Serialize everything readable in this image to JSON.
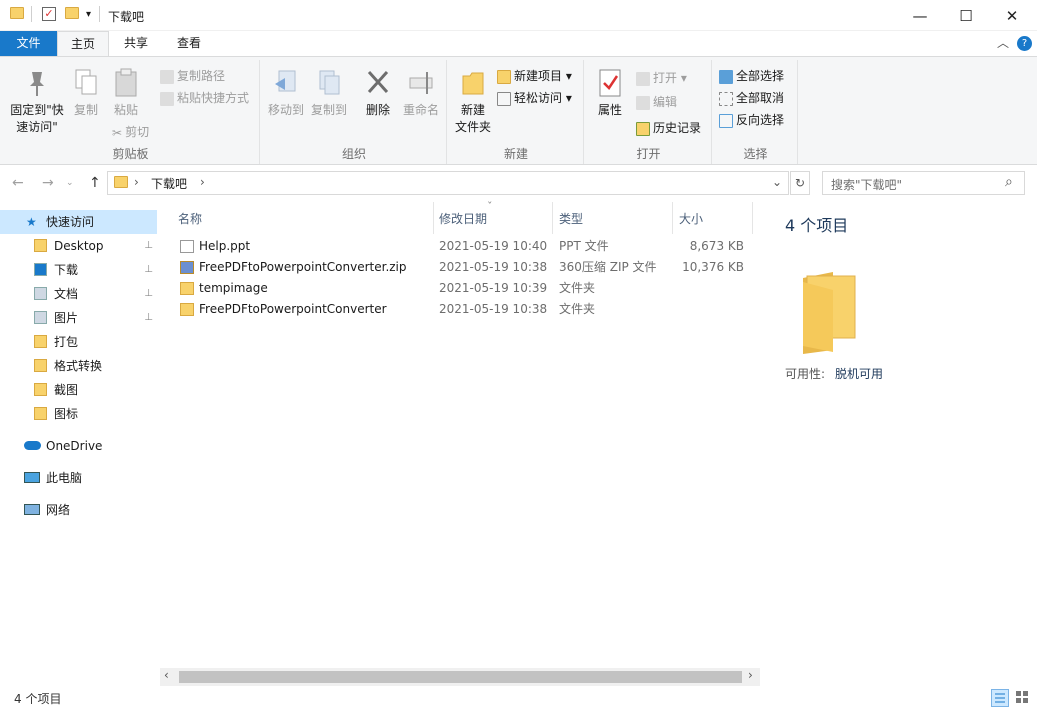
{
  "window": {
    "title": "下载吧",
    "minimize": "—",
    "maximize": "☐",
    "close": "✕",
    "qa_dropdown": "▾"
  },
  "ribbon_tabs": {
    "file": "文件",
    "home": "主页",
    "share": "共享",
    "view": "查看",
    "collapse": "︿",
    "help": "?"
  },
  "ribbon": {
    "clipboard": {
      "label": "剪贴板",
      "pin_line1": "固定到\"快",
      "pin_line2": "速访问\"",
      "copy": "复制",
      "paste": "粘贴",
      "copy_path": "复制路径",
      "paste_shortcut": "粘贴快捷方式",
      "cut": "剪切"
    },
    "organize": {
      "label": "组织",
      "move_to": "移动到",
      "copy_to": "复制到",
      "delete": "删除",
      "rename": "重命名"
    },
    "new": {
      "label": "新建",
      "new_folder_line1": "新建",
      "new_folder_line2": "文件夹",
      "new_item": "新建项目",
      "easy_access": "轻松访问"
    },
    "open": {
      "label": "打开",
      "properties": "属性",
      "open": "打开",
      "edit": "编辑",
      "history": "历史记录"
    },
    "select": {
      "label": "选择",
      "select_all": "全部选择",
      "select_none": "全部取消",
      "invert": "反向选择"
    }
  },
  "address": {
    "path": "下载吧",
    "separator": "›",
    "search_placeholder": "搜索\"下载吧\"",
    "back": "←",
    "forward": "→",
    "dropdown": "⌄",
    "up": "↑",
    "refresh": "↻",
    "search_icon": "⌕"
  },
  "nav": {
    "quick_access": "快速访问",
    "items": [
      {
        "label": "Desktop",
        "pinned": true
      },
      {
        "label": "下载",
        "pinned": true
      },
      {
        "label": "文档",
        "pinned": true
      },
      {
        "label": "图片",
        "pinned": true
      },
      {
        "label": "打包",
        "pinned": false
      },
      {
        "label": "格式转换",
        "pinned": false
      },
      {
        "label": "截图",
        "pinned": false
      },
      {
        "label": "图标",
        "pinned": false
      }
    ],
    "onedrive": "OneDrive",
    "this_pc": "此电脑",
    "network": "网络",
    "pin_glyph": "📌"
  },
  "filelist": {
    "columns": {
      "name": "名称",
      "modified": "修改日期",
      "type": "类型",
      "size": "大小"
    },
    "rows": [
      {
        "name": "Help.ppt",
        "modified": "2021-05-19 10:40",
        "type": "PPT 文件",
        "size": "8,673 KB",
        "icon": "document-icon"
      },
      {
        "name": "FreePDFtoPowerpointConverter.zip",
        "modified": "2021-05-19 10:38",
        "type": "360压缩 ZIP 文件",
        "size": "10,376 KB",
        "icon": "zip-icon"
      },
      {
        "name": "tempimage",
        "modified": "2021-05-19 10:39",
        "type": "文件夹",
        "size": "",
        "icon": "folder-icon"
      },
      {
        "name": "FreePDFtoPowerpointConverter",
        "modified": "2021-05-19 10:38",
        "type": "文件夹",
        "size": "",
        "icon": "folder-icon"
      }
    ],
    "sort_glyph": "ˇ"
  },
  "scroll": {
    "left": "‹",
    "right": "›"
  },
  "preview": {
    "count_title": "4 个项目",
    "availability_label": "可用性:",
    "availability_value": "脱机可用"
  },
  "status": {
    "count": "4 个项目"
  },
  "colors": {
    "accent": "#1979ca",
    "ribbon_bg": "#f5f6f7",
    "selected": "#cce8ff",
    "folder": "#f8d26b"
  }
}
